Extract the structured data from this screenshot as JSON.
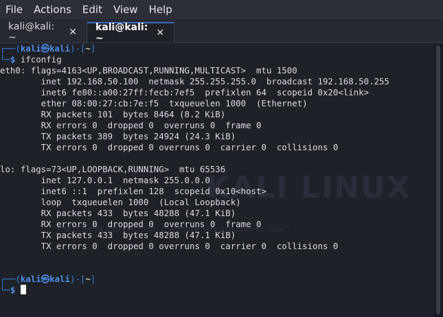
{
  "menu": [
    "File",
    "Actions",
    "Edit",
    "View",
    "Help"
  ],
  "tabs": [
    {
      "label": "kali@kali: ~",
      "close": "✕"
    },
    {
      "label": "kali@kali: ~",
      "close": "✕"
    }
  ],
  "watermark": {
    "text": "KALI LINUX",
    "quote": "\"the quieter you become, the more you are able to hear\""
  },
  "prompt": {
    "user": "kali",
    "host": "kali",
    "dir": "~",
    "at": "㉿",
    "corner_top": "┌──",
    "corner_bottom": "└─",
    "dollar": "$"
  },
  "command": "ifconfig",
  "output": [
    "eth0: flags=4163<UP,BROADCAST,RUNNING,MULTICAST>  mtu 1500",
    "        inet 192.168.50.100  netmask 255.255.255.0  broadcast 192.168.50.255",
    "        inet6 fe80::a00:27ff:fecb:7ef5  prefixlen 64  scopeid 0x20<link>",
    "        ether 08:00:27:cb:7e:f5  txqueuelen 1000  (Ethernet)",
    "        RX packets 101  bytes 8464 (8.2 KiB)",
    "        RX errors 0  dropped 0  overruns 0  frame 0",
    "        TX packets 389  bytes 24924 (24.3 KiB)",
    "        TX errors 0  dropped 0 overruns 0  carrier 0  collisions 0",
    "",
    "lo: flags=73<UP,LOOPBACK,RUNNING>  mtu 65536",
    "        inet 127.0.0.1  netmask 255.0.0.0",
    "        inet6 ::1  prefixlen 128  scopeid 0x10<host>",
    "        loop  txqueuelen 1000  (Local Loopback)",
    "        RX packets 433  bytes 48288 (47.1 KiB)",
    "        RX errors 0  dropped 0  overruns 0  frame 0",
    "        TX packets 433  bytes 48288 (47.1 KiB)",
    "        TX errors 0  dropped 0 overruns 0  carrier 0  collisions 0",
    "",
    ""
  ],
  "colors": {
    "prompt_blue": "#2f7fde",
    "background": "#1f2129",
    "tab_accent": "#3d6ec9"
  }
}
